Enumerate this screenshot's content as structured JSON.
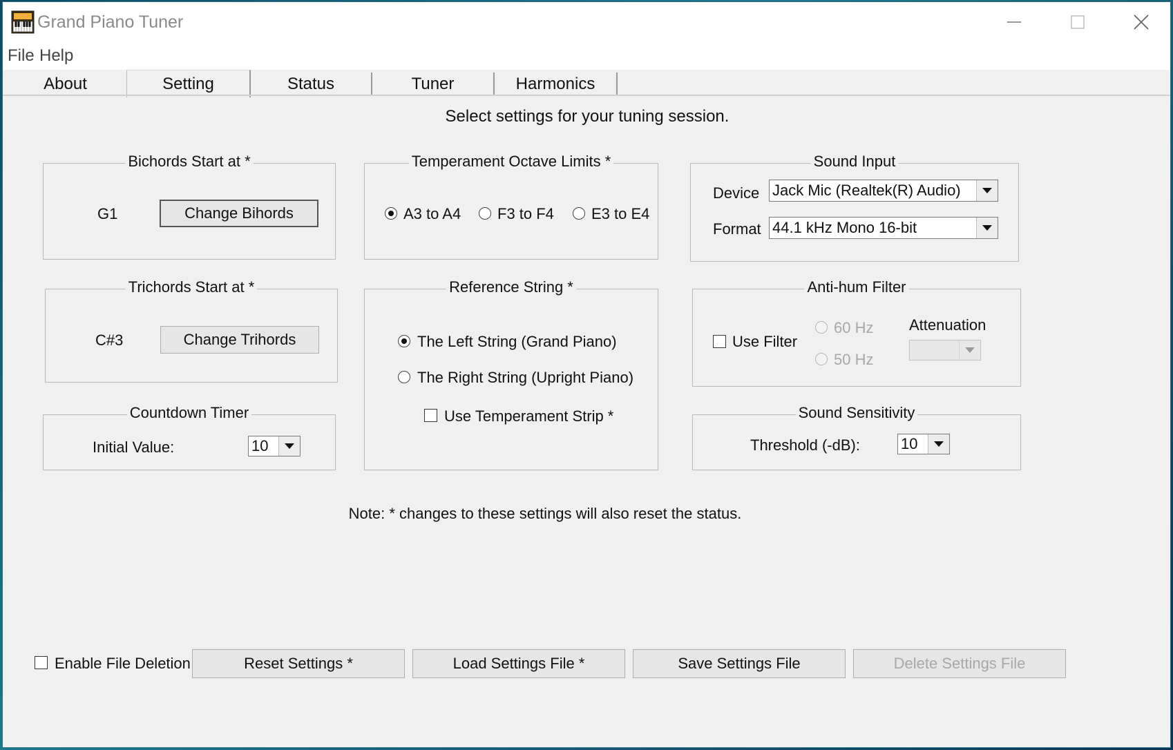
{
  "window": {
    "title": "Grand Piano Tuner"
  },
  "menu": {
    "file": "File",
    "help": "Help"
  },
  "tabs": [
    "About",
    "Setting",
    "Status",
    "Tuner",
    "Harmonics"
  ],
  "header": "Select settings for your tuning session.",
  "bichords": {
    "legend": "Bichords Start at *",
    "value": "G1",
    "button": "Change Bihords"
  },
  "trichords": {
    "legend": "Trichords Start at *",
    "value": "C#3",
    "button": "Change Trihords"
  },
  "countdown": {
    "legend": "Countdown Timer",
    "label": "Initial Value:",
    "value": "10"
  },
  "temperament": {
    "legend": "Temperament Octave Limits *",
    "options": [
      "A3 to A4",
      "F3 to F4",
      "E3 to E4"
    ],
    "selected": "A3 to A4"
  },
  "reference": {
    "legend": "Reference String *",
    "options": [
      "The Left String (Grand Piano)",
      "The Right String (Upright Piano)"
    ],
    "selected": "The Left String (Grand Piano)",
    "strip_label": "Use Temperament Strip *",
    "strip_checked": false
  },
  "sound_input": {
    "legend": "Sound Input",
    "device_label": "Device",
    "device_value": "Jack Mic (Realtek(R) Audio)",
    "format_label": "Format",
    "format_value": "44.1 kHz Mono 16-bit"
  },
  "antihum": {
    "legend": "Anti-hum Filter",
    "use_filter_label": "Use Filter",
    "use_filter_checked": false,
    "freq_options": [
      "60 Hz",
      "50 Hz"
    ],
    "attenuation_label": "Attenuation",
    "attenuation_value": ""
  },
  "sensitivity": {
    "legend": "Sound Sensitivity",
    "label": "Threshold (-dB):",
    "value": "10"
  },
  "note": "Note: * changes to these settings will also reset the status.",
  "footer": {
    "enable_deletion_label": "Enable File Deletion",
    "enable_deletion_checked": false,
    "reset": "Reset Settings *",
    "load": "Load Settings File *",
    "save": "Save Settings File",
    "delete": "Delete Settings File"
  },
  "icons": [
    "piano-app-icon",
    "minimize-icon",
    "maximize-icon",
    "close-icon",
    "dropdown-arrow-icon"
  ]
}
